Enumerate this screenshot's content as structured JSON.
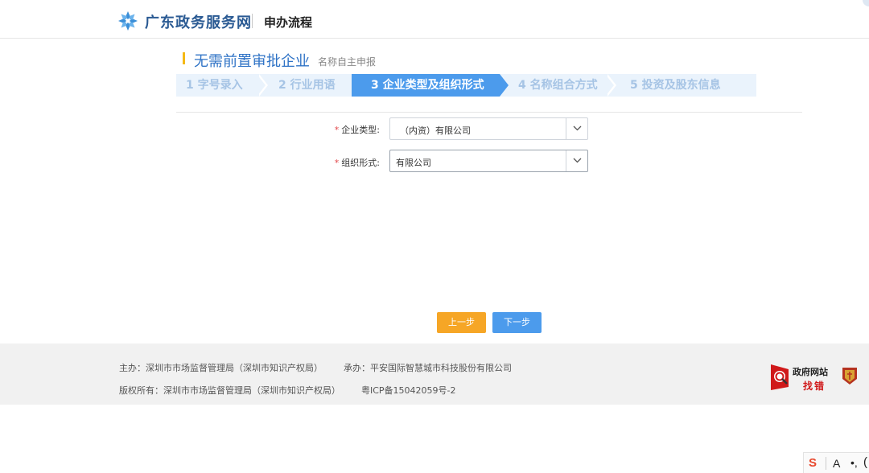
{
  "header": {
    "site_name": "广东政务服务网",
    "subtitle": "申办流程"
  },
  "page": {
    "title": "无需前置审批企业",
    "subtitle": "名称自主申报"
  },
  "steps": [
    {
      "label": "1 字号录入",
      "active": false
    },
    {
      "label": "2 行业用语",
      "active": false
    },
    {
      "label": "3 企业类型及组织形式",
      "active": true
    },
    {
      "label": "4 名称组合方式",
      "active": false
    },
    {
      "label": "5 投资及股东信息",
      "active": false
    }
  ],
  "form": {
    "required_mark": "*",
    "enterprise_type": {
      "label": "企业类型:",
      "value": "（内资）有限公司"
    },
    "org_form": {
      "label": "组织形式:",
      "value": "有限公司"
    }
  },
  "buttons": {
    "prev": "上一步",
    "next": "下一步"
  },
  "footer": {
    "host": "主办：深圳市市场监督管理局（深圳市知识产权局）",
    "contractor": "承办：平安国际智慧城市科技股份有限公司",
    "copyright": "版权所有：深圳市市场监督管理局（深圳市知识产权局）",
    "icp": "粤ICP备15042059号-2",
    "gov_badge_line1": "政府网站",
    "gov_badge_line2": "找错"
  },
  "widget": {
    "s": "S",
    "a": "A",
    "dot": "•,",
    "paren": "("
  },
  "colors": {
    "brand_blue": "#2a5a93",
    "accent_blue": "#4c9bec",
    "accent_orange": "#f6a626",
    "title_bar_yellow": "#f5b915",
    "required_red": "#e2474b"
  }
}
